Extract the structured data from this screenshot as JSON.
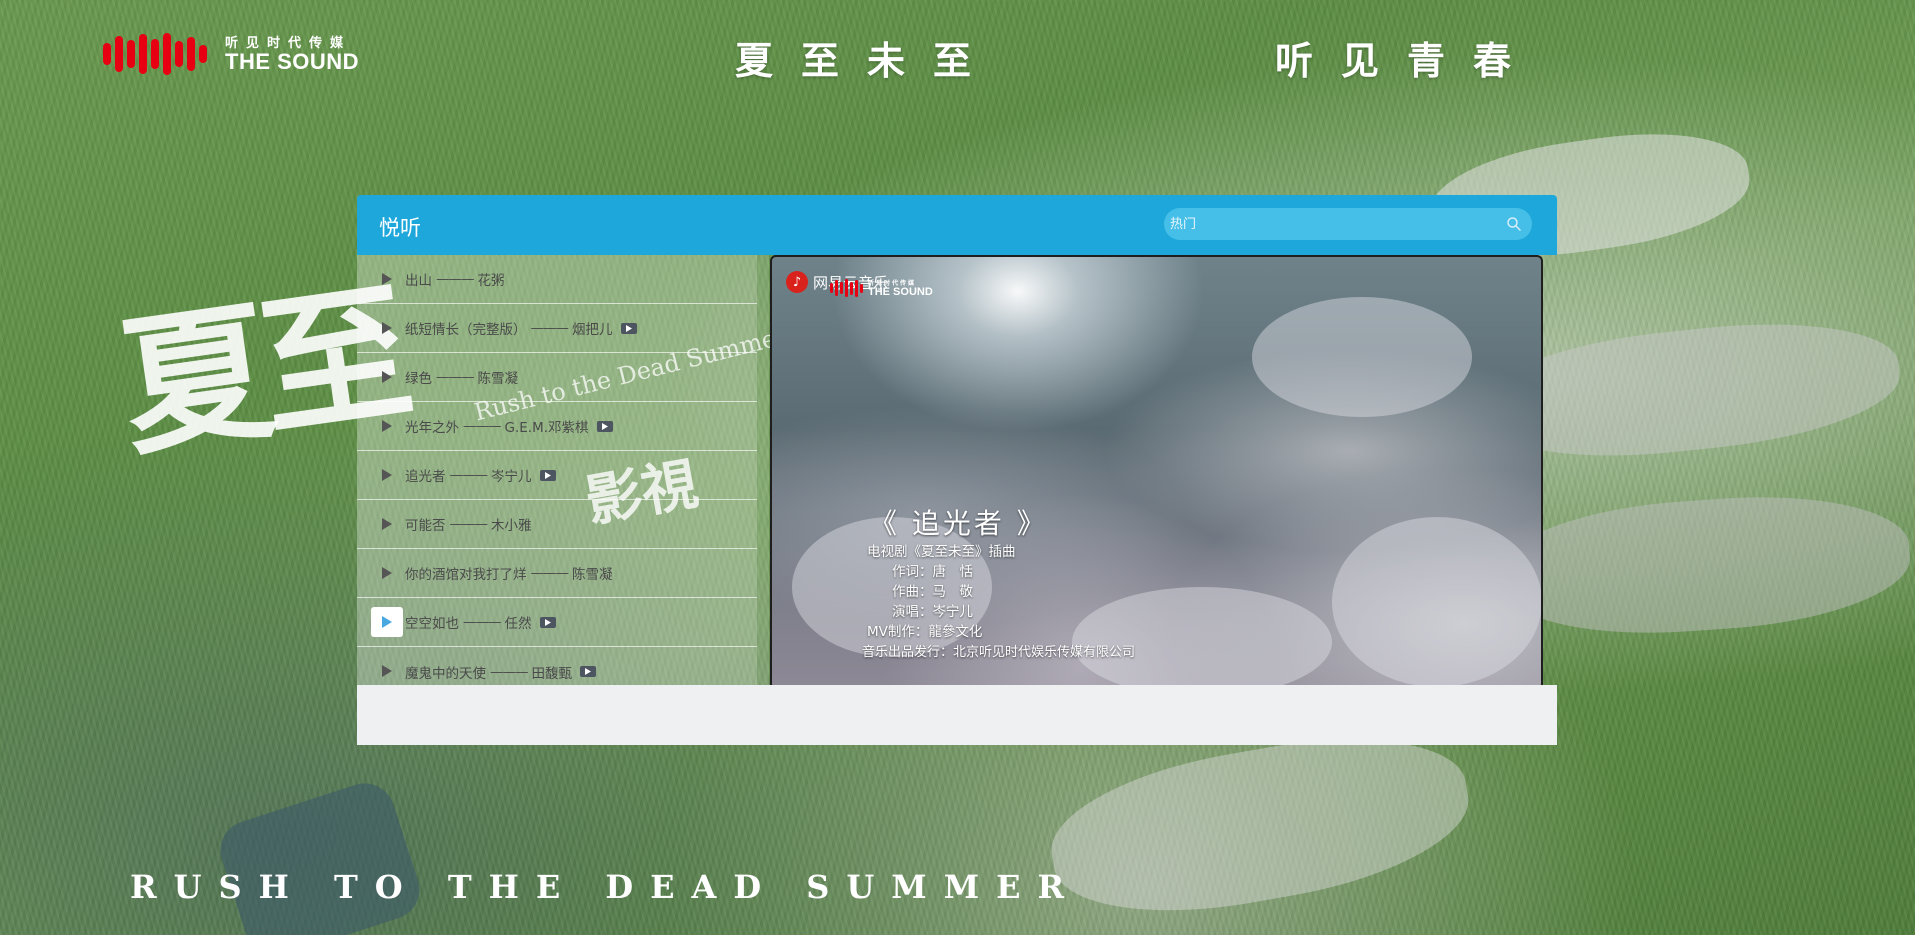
{
  "brand": {
    "cn_text": "听见时代传媒",
    "en_text": "THE SOUND",
    "accent_color": "#e60012"
  },
  "header": {
    "slogan_left": "夏至未至",
    "slogan_right": "听见青春"
  },
  "poster": {
    "title_glyphs": "夏至",
    "subtitle": "Rush to the Dead Summer",
    "mark": "影視",
    "bottom_tagline": "RUSH TO THE DEAD SUMMER"
  },
  "player": {
    "title": "悦听",
    "header_color": "#1ea7da",
    "search": {
      "placeholder": "热门",
      "value": "",
      "icon": "search-icon"
    },
    "playlist": [
      {
        "title": "出山",
        "separator": "———",
        "artist": "花粥",
        "has_mv": false,
        "active": false
      },
      {
        "title": "纸短情长（完整版）",
        "separator": "———",
        "artist": "烟把儿",
        "has_mv": true,
        "active": false
      },
      {
        "title": "绿色",
        "separator": "———",
        "artist": "陈雪凝",
        "has_mv": false,
        "active": false
      },
      {
        "title": "光年之外",
        "separator": "———",
        "artist": "G.E.M.邓紫棋",
        "has_mv": true,
        "active": false
      },
      {
        "title": "追光者",
        "separator": "———",
        "artist": "岑宁儿",
        "has_mv": true,
        "active": false
      },
      {
        "title": "可能否",
        "separator": "———",
        "artist": "木小雅",
        "has_mv": false,
        "active": false
      },
      {
        "title": "你的酒馆对我打了烊",
        "separator": "———",
        "artist": "陈雪凝",
        "has_mv": false,
        "active": false
      },
      {
        "title": "空空如也",
        "separator": "———",
        "artist": "任然",
        "has_mv": true,
        "active": true
      },
      {
        "title": "魔鬼中的天使",
        "separator": "———",
        "artist": "田馥甄",
        "has_mv": true,
        "active": false
      }
    ],
    "video": {
      "watermark_netease": "网易云音乐",
      "watermark_sound_cn": "听见时代传媒",
      "watermark_sound_en": "THE SOUND",
      "song_title": "《 追光者 》",
      "credits": [
        "电视剧《夏至未至》插曲",
        "作词：唐　恬",
        "作曲：马　敬",
        "演唱：岑宁儿",
        "MV制作：龍參文化"
      ],
      "publisher": "音乐出品发行：北京听见时代娱乐传媒有限公司"
    }
  }
}
